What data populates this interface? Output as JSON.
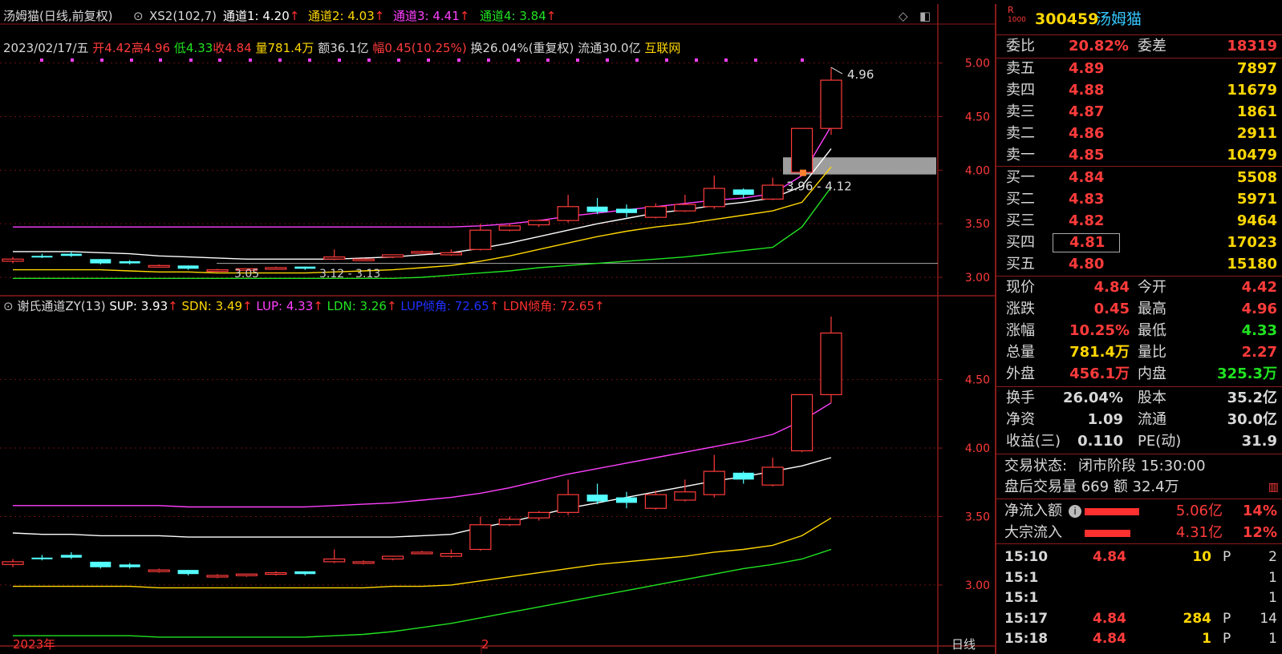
{
  "main_panel": {
    "title": "汤姆猫(日线,前复权)",
    "indicator": "XS2(102,7)",
    "channels": [
      {
        "label": "通道1: 4.20",
        "color": "#ffffff"
      },
      {
        "label": "通道2: 4.03",
        "color": "#ffd700"
      },
      {
        "label": "通道3: 4.41",
        "color": "#ff40ff"
      },
      {
        "label": "通道4: 3.84",
        "color": "#21e321"
      }
    ],
    "info": {
      "date": "2023/02/17/五",
      "open": "开4.42",
      "high": "高4.96",
      "low": "低4.33",
      "close": "收4.84",
      "volume": "量781.4万",
      "amount": "额36.1亿",
      "change": "幅0.45(10.25%)",
      "turnover": "换26.04%(重复权)",
      "float": "流通30.0亿",
      "sector": "互联网"
    },
    "annotations": {
      "high_label": "4.96",
      "zone_label": "3.96 - 4.12",
      "low1": "3.05",
      "low2": "3.12 - 3.13"
    },
    "y_ticks": [
      "5.00",
      "4.50",
      "4.00",
      "3.50",
      "3.00"
    ]
  },
  "sub_panel": {
    "indicator": "谢氏通道ZY(13)",
    "values": [
      {
        "label": "SUP: 3.93",
        "color": "#ffffff"
      },
      {
        "label": "SDN: 3.49",
        "color": "#ffd700"
      },
      {
        "label": "LUP: 4.33",
        "color": "#ff40ff"
      },
      {
        "label": "LDN: 3.26",
        "color": "#21e321"
      },
      {
        "label": "LUP倾角: 72.65",
        "color": "#2030ff"
      },
      {
        "label": "LDN倾角: 72.65",
        "color": "#ff3030"
      }
    ],
    "y_ticks": [
      "4.50",
      "4.00",
      "3.50",
      "3.00"
    ]
  },
  "bottom_axis": {
    "year": "2023年",
    "month": "2",
    "period": "日线"
  },
  "quote": {
    "badge_top": "R",
    "badge_bottom": "1000",
    "code": "300459",
    "name": "汤姆猫",
    "weibi_label": "委比",
    "weibi": "20.82%",
    "weicha_label": "委差",
    "weicha": "18319",
    "asks": [
      {
        "label": "卖五",
        "price": "4.89",
        "vol": "7897"
      },
      {
        "label": "卖四",
        "price": "4.88",
        "vol": "11679"
      },
      {
        "label": "卖三",
        "price": "4.87",
        "vol": "1861"
      },
      {
        "label": "卖二",
        "price": "4.86",
        "vol": "2911"
      },
      {
        "label": "卖一",
        "price": "4.85",
        "vol": "10479"
      }
    ],
    "bids": [
      {
        "label": "买一",
        "price": "4.84",
        "vol": "5508"
      },
      {
        "label": "买二",
        "price": "4.83",
        "vol": "5971"
      },
      {
        "label": "买三",
        "price": "4.82",
        "vol": "9464"
      },
      {
        "label": "买四",
        "price": "4.81",
        "vol": "17023"
      },
      {
        "label": "买五",
        "price": "4.80",
        "vol": "15180"
      }
    ],
    "stats": [
      {
        "l1": "现价",
        "v1": "4.84",
        "c1": "red",
        "l2": "今开",
        "v2": "4.42",
        "c2": "red"
      },
      {
        "l1": "涨跌",
        "v1": "0.45",
        "c1": "red",
        "l2": "最高",
        "v2": "4.96",
        "c2": "red"
      },
      {
        "l1": "涨幅",
        "v1": "10.25%",
        "c1": "red",
        "l2": "最低",
        "v2": "4.33",
        "c2": "green"
      },
      {
        "l1": "总量",
        "v1": "781.4万",
        "c1": "yellow",
        "l2": "量比",
        "v2": "2.27",
        "c2": "red"
      },
      {
        "l1": "外盘",
        "v1": "456.1万",
        "c1": "red",
        "l2": "内盘",
        "v2": "325.3万",
        "c2": "green"
      }
    ],
    "fund": [
      {
        "l1": "换手",
        "v1": "26.04%",
        "l2": "股本",
        "v2": "35.2亿"
      },
      {
        "l1": "净资",
        "v1": "1.09",
        "l2": "流通",
        "v2": "30.0亿"
      },
      {
        "l1": "收益(三)",
        "v1": "0.110",
        "l2": "PE(动)",
        "v2": "31.9"
      }
    ],
    "status_label": "交易状态:",
    "status": "闭市阶段 15:30:00",
    "after_hours": "盘后交易量 669 额 32.4万",
    "flows": [
      {
        "label": "净流入额",
        "value": "5.06亿",
        "pct": "14%",
        "fill": 0.9
      },
      {
        "label": "大宗流入",
        "value": "4.31亿",
        "pct": "12%",
        "fill": 0.75
      }
    ],
    "ticks": [
      {
        "time": "15:10",
        "price": "4.84",
        "vol": "10",
        "side": "P",
        "n": "2"
      },
      {
        "time": "15:1",
        "price": "",
        "vol": "",
        "side": "",
        "n": "1"
      },
      {
        "time": "15:1",
        "price": "",
        "vol": "",
        "side": "",
        "n": "1"
      },
      {
        "time": "15:17",
        "price": "4.84",
        "vol": "284",
        "side": "P",
        "n": "14"
      },
      {
        "time": "15:18",
        "price": "4.84",
        "vol": "1",
        "side": "P",
        "n": "1"
      }
    ]
  },
  "chart_data": {
    "type": "candlestick",
    "ohlc": [
      [
        3.15,
        3.19,
        3.13,
        3.17
      ],
      [
        3.2,
        3.22,
        3.18,
        3.19
      ],
      [
        3.22,
        3.24,
        3.19,
        3.2
      ],
      [
        3.17,
        3.17,
        3.12,
        3.13
      ],
      [
        3.15,
        3.16,
        3.12,
        3.13
      ],
      [
        3.1,
        3.12,
        3.09,
        3.11
      ],
      [
        3.11,
        3.11,
        3.07,
        3.08
      ],
      [
        3.06,
        3.08,
        3.05,
        3.07
      ],
      [
        3.07,
        3.08,
        3.06,
        3.08
      ],
      [
        3.08,
        3.1,
        3.07,
        3.09
      ],
      [
        3.1,
        3.1,
        3.07,
        3.08
      ],
      [
        3.17,
        3.26,
        3.16,
        3.19
      ],
      [
        3.16,
        3.18,
        3.15,
        3.17
      ],
      [
        3.19,
        3.21,
        3.18,
        3.21
      ],
      [
        3.24,
        3.25,
        3.23,
        3.24
      ],
      [
        3.21,
        3.26,
        3.2,
        3.23
      ],
      [
        3.26,
        3.5,
        3.25,
        3.44
      ],
      [
        3.44,
        3.5,
        3.43,
        3.48
      ],
      [
        3.49,
        3.54,
        3.47,
        3.53
      ],
      [
        3.53,
        3.77,
        3.51,
        3.66
      ],
      [
        3.66,
        3.74,
        3.59,
        3.61
      ],
      [
        3.64,
        3.68,
        3.56,
        3.6
      ],
      [
        3.56,
        3.69,
        3.55,
        3.66
      ],
      [
        3.62,
        3.77,
        3.61,
        3.68
      ],
      [
        3.66,
        3.95,
        3.64,
        3.83
      ],
      [
        3.82,
        3.83,
        3.74,
        3.77
      ],
      [
        3.73,
        3.93,
        3.72,
        3.86
      ],
      [
        3.98,
        4.33,
        3.97,
        4.39
      ],
      [
        4.39,
        4.96,
        4.33,
        4.84
      ]
    ],
    "ma_white": [
      3.24,
      3.24,
      3.24,
      3.23,
      3.22,
      3.2,
      3.19,
      3.18,
      3.17,
      3.17,
      3.17,
      3.17,
      3.18,
      3.19,
      3.21,
      3.23,
      3.27,
      3.32,
      3.38,
      3.44,
      3.5,
      3.55,
      3.6,
      3.63,
      3.67,
      3.7,
      3.74,
      3.85,
      4.2
    ],
    "ma_yellow": [
      3.07,
      3.07,
      3.07,
      3.07,
      3.06,
      3.05,
      3.05,
      3.04,
      3.04,
      3.04,
      3.04,
      3.05,
      3.06,
      3.07,
      3.09,
      3.11,
      3.15,
      3.2,
      3.26,
      3.32,
      3.38,
      3.43,
      3.47,
      3.5,
      3.54,
      3.58,
      3.62,
      3.7,
      4.03
    ],
    "ma_magenta": [
      3.47,
      3.47,
      3.47,
      3.47,
      3.47,
      3.47,
      3.47,
      3.47,
      3.47,
      3.47,
      3.47,
      3.47,
      3.47,
      3.47,
      3.47,
      3.47,
      3.48,
      3.5,
      3.53,
      3.57,
      3.6,
      3.63,
      3.66,
      3.69,
      3.72,
      3.74,
      3.78,
      3.95,
      4.41
    ],
    "ma_green": [
      2.99,
      2.99,
      2.99,
      2.99,
      2.99,
      2.99,
      2.99,
      2.99,
      2.99,
      2.99,
      2.99,
      2.99,
      2.99,
      2.99,
      3.0,
      3.02,
      3.04,
      3.06,
      3.09,
      3.11,
      3.13,
      3.15,
      3.17,
      3.19,
      3.22,
      3.25,
      3.28,
      3.47,
      3.84
    ],
    "sub_white": [
      3.38,
      3.37,
      3.37,
      3.36,
      3.36,
      3.36,
      3.35,
      3.35,
      3.35,
      3.35,
      3.35,
      3.35,
      3.35,
      3.35,
      3.36,
      3.37,
      3.42,
      3.46,
      3.51,
      3.56,
      3.6,
      3.64,
      3.68,
      3.72,
      3.76,
      3.79,
      3.83,
      3.87,
      3.93
    ],
    "sub_yellow": [
      2.99,
      2.99,
      2.99,
      2.99,
      2.99,
      2.98,
      2.98,
      2.98,
      2.98,
      2.98,
      2.98,
      2.98,
      2.98,
      2.99,
      2.99,
      3.0,
      3.03,
      3.06,
      3.09,
      3.12,
      3.15,
      3.17,
      3.19,
      3.21,
      3.24,
      3.26,
      3.29,
      3.36,
      3.49
    ],
    "sub_magenta": [
      3.58,
      3.58,
      3.58,
      3.58,
      3.58,
      3.58,
      3.57,
      3.57,
      3.57,
      3.57,
      3.57,
      3.58,
      3.59,
      3.6,
      3.62,
      3.64,
      3.67,
      3.71,
      3.76,
      3.81,
      3.85,
      3.89,
      3.93,
      3.97,
      4.01,
      4.05,
      4.1,
      4.2,
      4.33
    ],
    "sub_green": [
      2.63,
      2.63,
      2.63,
      2.63,
      2.63,
      2.62,
      2.62,
      2.62,
      2.62,
      2.62,
      2.62,
      2.63,
      2.64,
      2.66,
      2.69,
      2.72,
      2.76,
      2.8,
      2.84,
      2.88,
      2.92,
      2.96,
      3.0,
      3.04,
      3.08,
      3.12,
      3.15,
      3.19,
      3.26
    ],
    "main_ylim": [
      2.97,
      5.05
    ],
    "sub_ylim": [
      2.59,
      4.96
    ],
    "zone": [
      3.96,
      4.12
    ]
  }
}
